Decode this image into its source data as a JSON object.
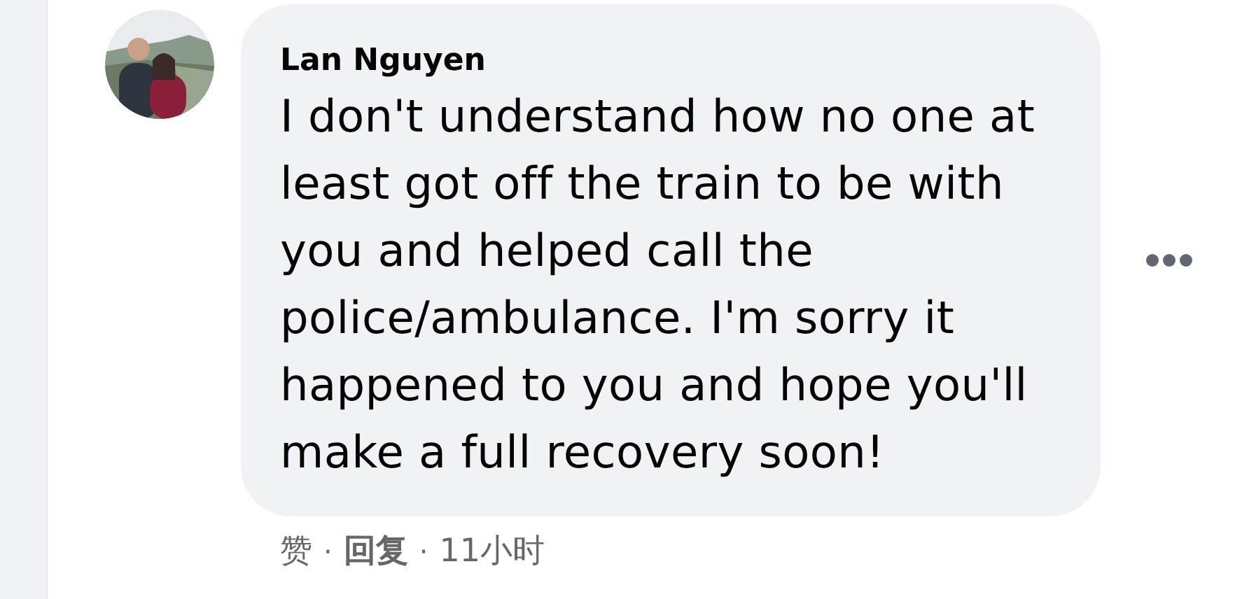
{
  "comment": {
    "author": "Lan Nguyen",
    "text": "I don't understand how no one at least got off the train to be with you and helped call the police/ambulance. I'm sorry it happened to you and hope you'll make a full recovery soon!"
  },
  "actions": {
    "like": "赞",
    "separator": "·",
    "reply": "回复",
    "time": "11小时"
  }
}
